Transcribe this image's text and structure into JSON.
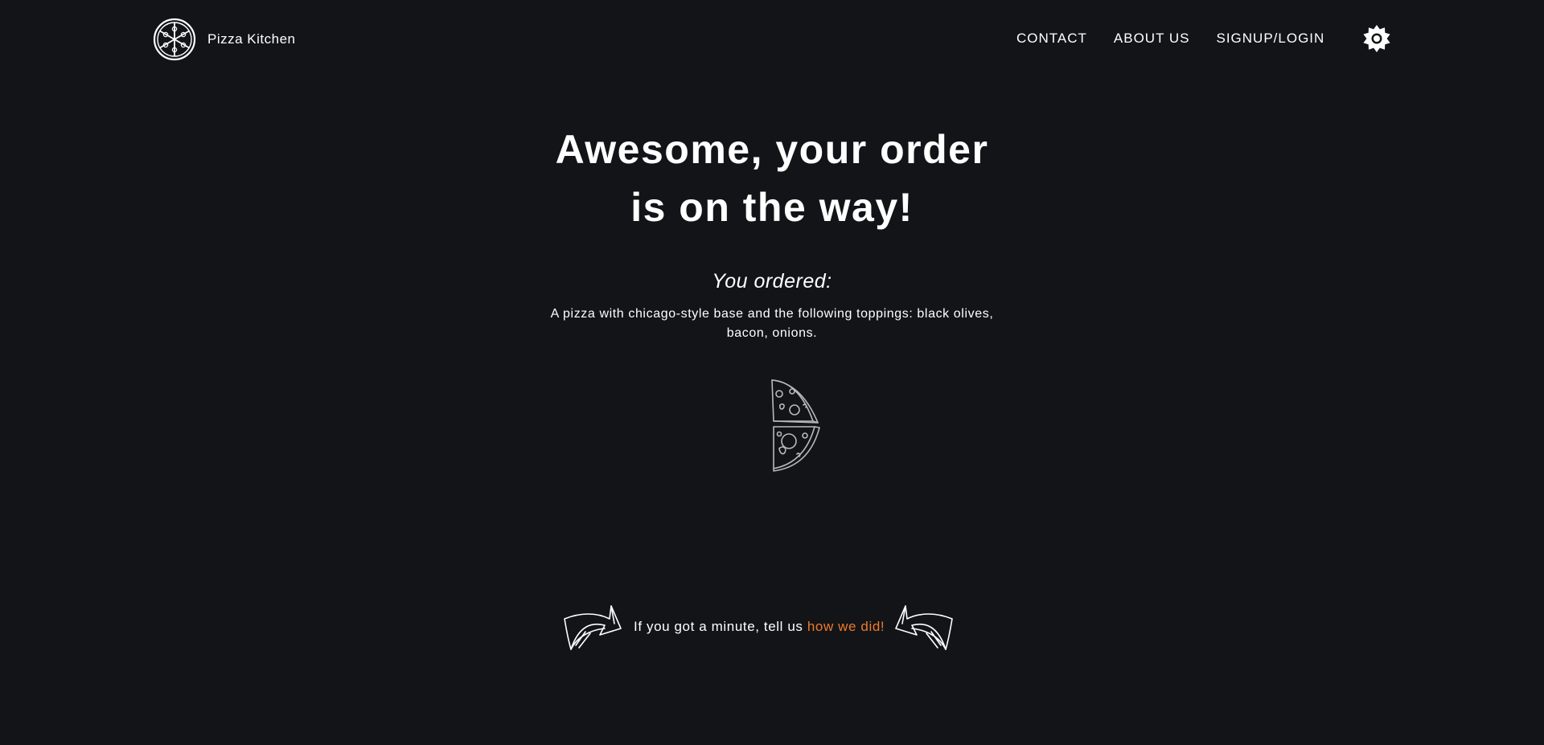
{
  "brand": {
    "name": "Pizza Kitchen",
    "logo_icon": "pizza-logo-icon"
  },
  "nav": {
    "items": [
      {
        "label": "CONTACT"
      },
      {
        "label": "ABOUT US"
      },
      {
        "label": "SIGNUP/LOGIN"
      }
    ],
    "theme_toggle_icon": "sun-gear-icon"
  },
  "main": {
    "headline_line1": "Awesome, your order",
    "headline_line2": "is on the way!",
    "subhead": "You ordered:",
    "order_description": "A pizza with chicago-style base and the following toppings: black olives, bacon, onions.",
    "illustration_icon": "pizza-slices-icon"
  },
  "feedback": {
    "text": "If you got a minute, tell us ",
    "link_label": "how we did!",
    "left_arrow_icon": "hand-drawn-arrow-right-icon",
    "right_arrow_icon": "hand-drawn-arrow-left-icon"
  },
  "colors": {
    "background": "#131418",
    "text": "#ffffff",
    "accent": "#ee7a2a"
  }
}
